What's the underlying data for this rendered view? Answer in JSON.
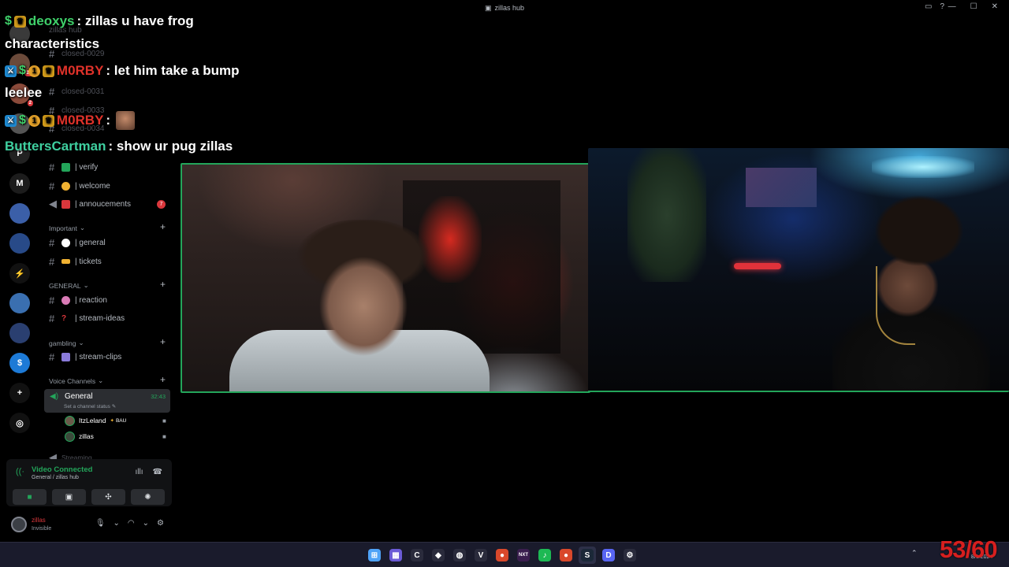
{
  "window": {
    "title": "zillas hub",
    "icons": [
      "inbox-icon",
      "help-icon"
    ],
    "controls": [
      "minimize",
      "maximize",
      "close"
    ]
  },
  "servers": [
    {
      "name": "server-1",
      "color": "#3a3a3a",
      "text": "",
      "badge": ""
    },
    {
      "name": "server-2",
      "color": "#6b4a3a",
      "text": "",
      "badge": "21"
    },
    {
      "name": "server-3",
      "color": "#8a4a3a",
      "text": "",
      "badge": "2"
    },
    {
      "name": "server-4",
      "color": "#555",
      "text": "",
      "badge": ""
    },
    {
      "name": "server-5",
      "color": "#222",
      "text": "P",
      "badge": ""
    },
    {
      "name": "server-6",
      "color": "#1c1c1c",
      "text": "M",
      "badge": ""
    },
    {
      "name": "server-7",
      "color": "#3b5fa8",
      "text": "",
      "badge": ""
    },
    {
      "name": "server-8",
      "color": "#284a88",
      "text": "",
      "badge": ""
    },
    {
      "name": "server-9",
      "color": "#111",
      "text": "⚡",
      "badge": ""
    },
    {
      "name": "server-10",
      "color": "#3a6fb0",
      "text": "",
      "badge": ""
    },
    {
      "name": "server-11",
      "color": "#2a3f70",
      "text": "",
      "badge": ""
    },
    {
      "name": "server-12",
      "color": "#1d7ad6",
      "text": "$",
      "badge": ""
    },
    {
      "name": "add-server",
      "color": "#111",
      "text": "+",
      "badge": ""
    },
    {
      "name": "discover",
      "color": "#111",
      "text": "◎",
      "badge": ""
    }
  ],
  "sidebar": {
    "faded_channels": [
      "zillas hub",
      "closed-0029",
      "closed-0031",
      "closed-0033",
      "closed-0034"
    ],
    "top_channels": [
      {
        "label": "| verify",
        "emoji_color": "#23a55a"
      },
      {
        "label": "| welcome",
        "emoji_color": "#f0b232"
      },
      {
        "label": "| annoucements",
        "emoji_color": "#da373c",
        "badge": "7"
      }
    ],
    "categories": [
      {
        "label": "Important",
        "channels": [
          {
            "label": "| general",
            "emoji_color": "#ffffff"
          },
          {
            "label": "| tickets",
            "emoji_color": "#f0b232"
          }
        ]
      },
      {
        "label": "GENERAL",
        "channels": [
          {
            "label": "| reaction",
            "emoji_color": "#da7bb6"
          },
          {
            "label": "| stream-ideas",
            "emoji_color": "#da373c"
          }
        ]
      },
      {
        "label": "gambling",
        "channels": [
          {
            "label": "| stream-clips",
            "emoji_color": "#8a7bda"
          }
        ]
      },
      {
        "label": "Voice Channels",
        "channels": []
      }
    ],
    "voice": {
      "channel": "General",
      "status": "Set a channel status",
      "time": "32:43",
      "users": [
        {
          "name": "ItzLeland",
          "tag": "BAU"
        },
        {
          "name": "zillas",
          "tag": ""
        }
      ],
      "next_channel": "Streaming"
    }
  },
  "voice_panel": {
    "title": "Video Connected",
    "subtitle": "General / zillas hub"
  },
  "user_panel": {
    "name": "zillas",
    "status": "Invisible"
  },
  "chat": [
    {
      "user": "deoxys",
      "user_color": "#3fd06a",
      "text": ": zillas u have frog",
      "wrap": "characteristics"
    },
    {
      "user": "M0RBY",
      "user_color": "#e0322a",
      "text": ": let him take a bump",
      "wrap": "leelee"
    },
    {
      "user": "M0RBY",
      "user_color": "#e0322a",
      "text": ":",
      "wrap": ""
    },
    {
      "user": "ButtersCartman",
      "user_color": "#3fd0a0",
      "text": ": show ur pug zillas",
      "wrap": ""
    }
  ],
  "taskbar": {
    "apps": [
      {
        "name": "start",
        "color": "#4fa3f7",
        "text": "⊞"
      },
      {
        "name": "apps",
        "color": "#6b5bd6",
        "text": "▦"
      },
      {
        "name": "app-c",
        "color": "#2a2b3c",
        "text": "C"
      },
      {
        "name": "app-vpn",
        "color": "#2a2b3c",
        "text": "◆"
      },
      {
        "name": "obs",
        "color": "#2a2b3c",
        "text": "◍"
      },
      {
        "name": "vs",
        "color": "#2a2b3c",
        "text": "V"
      },
      {
        "name": "chrome",
        "color": "#d9482b",
        "text": "●"
      },
      {
        "name": "next",
        "color": "#3a1e4e",
        "text": "NXT"
      },
      {
        "name": "spotify",
        "color": "#1db954",
        "text": "♪"
      },
      {
        "name": "chrome-2",
        "color": "#d9482b",
        "text": "●"
      },
      {
        "name": "steam",
        "color": "#1b2838",
        "text": "S"
      },
      {
        "name": "discord",
        "color": "#5865f2",
        "text": "D"
      },
      {
        "name": "app-settings",
        "color": "#2a2b3c",
        "text": "⚙"
      }
    ],
    "date": "8/1/2024"
  },
  "counter": "53/60"
}
